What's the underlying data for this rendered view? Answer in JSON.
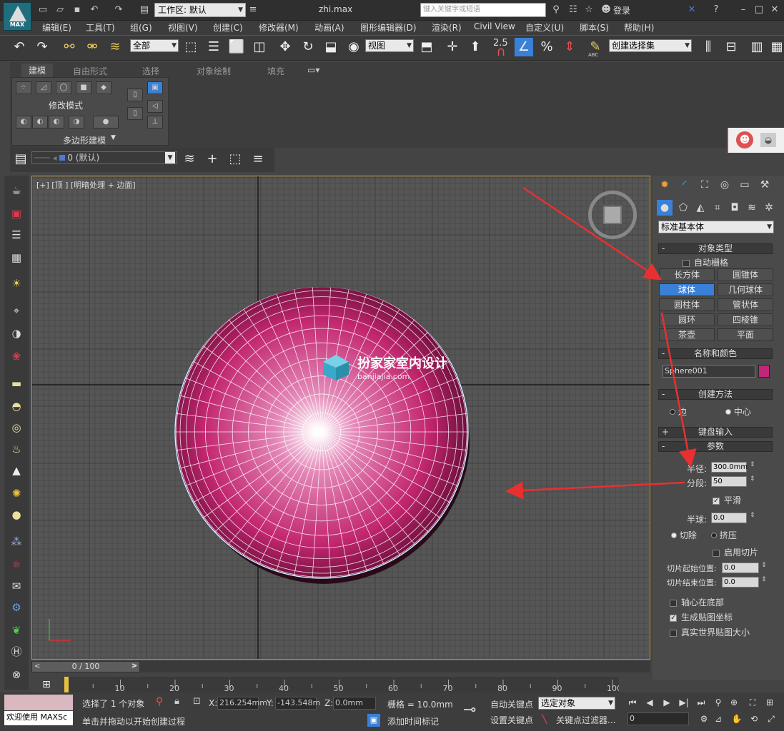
{
  "app": {
    "logo_text": "MAX",
    "workspace_label": "工作区: 默认",
    "filename": "zhi.max",
    "search_placeholder": "键入关键字或短语",
    "login": "登录"
  },
  "menu": [
    "编辑(E)",
    "工具(T)",
    "组(G)",
    "视图(V)",
    "创建(C)",
    "修改器(M)",
    "动画(A)",
    "图形编辑器(D)",
    "渲染(R)",
    "Civil View",
    "自定义(U)",
    "脚本(S)",
    "帮助(H)"
  ],
  "toolbar": {
    "selection_filter": "全部",
    "ref_coord": "视图",
    "snap_value": "2.5",
    "named_selection": "创建选择集",
    "abc_label": "ABC"
  },
  "ribbon": {
    "tabs": [
      "建模",
      "自由形式",
      "选择",
      "对象绘制",
      "填充"
    ],
    "panel_title": "修改模式",
    "panel_footer": "多边形建模"
  },
  "layer": {
    "current": "0 (默认)"
  },
  "viewport": {
    "label": "[+] [顶 ] [明暗处理 + 边面]",
    "watermark_title": "扮家家室内设计",
    "watermark_sub": "banjiajia.com",
    "sphere_color": "#c2266f",
    "wire_color": "#ffffff"
  },
  "command_panel": {
    "category": "标准基本体",
    "object_type": {
      "title": "对象类型",
      "autogrid": "自动栅格",
      "buttons": [
        {
          "label": "长方体",
          "selected": false
        },
        {
          "label": "圆锥体",
          "selected": false
        },
        {
          "label": "球体",
          "selected": true
        },
        {
          "label": "几何球体",
          "selected": false
        },
        {
          "label": "圆柱体",
          "selected": false
        },
        {
          "label": "管状体",
          "selected": false
        },
        {
          "label": "圆环",
          "selected": false
        },
        {
          "label": "四棱锥",
          "selected": false
        },
        {
          "label": "茶壶",
          "selected": false
        },
        {
          "label": "平面",
          "selected": false
        }
      ]
    },
    "name_color": {
      "title": "名称和颜色",
      "name": "Sphere001",
      "color": "#c2267a"
    },
    "creation_method": {
      "title": "创建方法",
      "edge": "边",
      "center": "中心"
    },
    "keyboard": {
      "title": "键盘输入"
    },
    "params": {
      "title": "参数",
      "radius_label": "半径:",
      "radius": "300.0mm",
      "segments_label": "分段:",
      "segments": "50",
      "smooth": "平滑",
      "hemisphere_label": "半球:",
      "hemisphere": "0.0",
      "chop": "切除",
      "squash": "挤压",
      "slice_on": "启用切片",
      "slice_from_label": "切片起始位置:",
      "slice_from": "0.0",
      "slice_to_label": "切片结束位置:",
      "slice_to": "0.0",
      "base_pivot": "轴心在底部",
      "gen_map": "生成贴图坐标",
      "real_world": "真实世界贴图大小"
    }
  },
  "timeline": {
    "slider": "0 / 100",
    "ticks": [
      "10",
      "20",
      "30",
      "40",
      "50",
      "60",
      "70",
      "80",
      "90",
      "100"
    ]
  },
  "status": {
    "selected": "选择了 1 个对象",
    "prompt": "单击并拖动以开始创建过程",
    "welcome": "欢迎使用 MAXSc",
    "x_label": "X:",
    "x": "216.254mm",
    "y_label": "Y:",
    "y": "-143.548m",
    "z_label": "Z:",
    "z": "0.0mm",
    "grid": "栅格 = 10.0mm",
    "add_time_tag": "添加时间标记",
    "auto_key": "自动关键点",
    "set_key": "设置关键点",
    "key_mode": "选定对象",
    "key_filters": "关键点过滤器...",
    "frame": "0"
  }
}
